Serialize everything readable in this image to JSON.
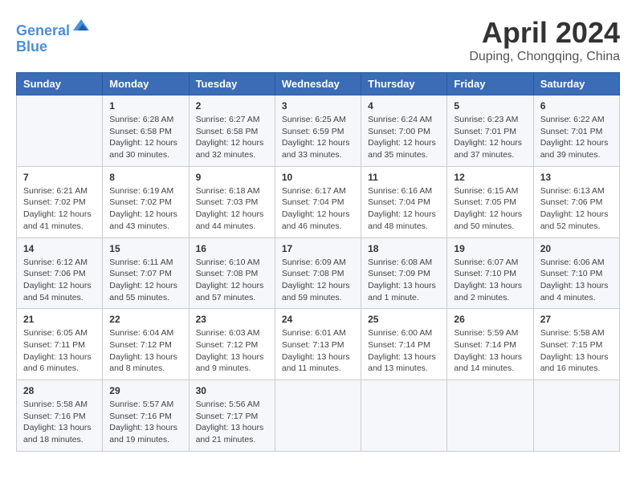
{
  "logo": {
    "line1": "General",
    "line2": "Blue"
  },
  "title": "April 2024",
  "subtitle": "Duping, Chongqing, China",
  "headers": [
    "Sunday",
    "Monday",
    "Tuesday",
    "Wednesday",
    "Thursday",
    "Friday",
    "Saturday"
  ],
  "weeks": [
    [
      {
        "day": "",
        "sunrise": "",
        "sunset": "",
        "daylight": ""
      },
      {
        "day": "1",
        "sunrise": "Sunrise: 6:28 AM",
        "sunset": "Sunset: 6:58 PM",
        "daylight": "Daylight: 12 hours and 30 minutes."
      },
      {
        "day": "2",
        "sunrise": "Sunrise: 6:27 AM",
        "sunset": "Sunset: 6:58 PM",
        "daylight": "Daylight: 12 hours and 32 minutes."
      },
      {
        "day": "3",
        "sunrise": "Sunrise: 6:25 AM",
        "sunset": "Sunset: 6:59 PM",
        "daylight": "Daylight: 12 hours and 33 minutes."
      },
      {
        "day": "4",
        "sunrise": "Sunrise: 6:24 AM",
        "sunset": "Sunset: 7:00 PM",
        "daylight": "Daylight: 12 hours and 35 minutes."
      },
      {
        "day": "5",
        "sunrise": "Sunrise: 6:23 AM",
        "sunset": "Sunset: 7:01 PM",
        "daylight": "Daylight: 12 hours and 37 minutes."
      },
      {
        "day": "6",
        "sunrise": "Sunrise: 6:22 AM",
        "sunset": "Sunset: 7:01 PM",
        "daylight": "Daylight: 12 hours and 39 minutes."
      }
    ],
    [
      {
        "day": "7",
        "sunrise": "Sunrise: 6:21 AM",
        "sunset": "Sunset: 7:02 PM",
        "daylight": "Daylight: 12 hours and 41 minutes."
      },
      {
        "day": "8",
        "sunrise": "Sunrise: 6:19 AM",
        "sunset": "Sunset: 7:02 PM",
        "daylight": "Daylight: 12 hours and 43 minutes."
      },
      {
        "day": "9",
        "sunrise": "Sunrise: 6:18 AM",
        "sunset": "Sunset: 7:03 PM",
        "daylight": "Daylight: 12 hours and 44 minutes."
      },
      {
        "day": "10",
        "sunrise": "Sunrise: 6:17 AM",
        "sunset": "Sunset: 7:04 PM",
        "daylight": "Daylight: 12 hours and 46 minutes."
      },
      {
        "day": "11",
        "sunrise": "Sunrise: 6:16 AM",
        "sunset": "Sunset: 7:04 PM",
        "daylight": "Daylight: 12 hours and 48 minutes."
      },
      {
        "day": "12",
        "sunrise": "Sunrise: 6:15 AM",
        "sunset": "Sunset: 7:05 PM",
        "daylight": "Daylight: 12 hours and 50 minutes."
      },
      {
        "day": "13",
        "sunrise": "Sunrise: 6:13 AM",
        "sunset": "Sunset: 7:06 PM",
        "daylight": "Daylight: 12 hours and 52 minutes."
      }
    ],
    [
      {
        "day": "14",
        "sunrise": "Sunrise: 6:12 AM",
        "sunset": "Sunset: 7:06 PM",
        "daylight": "Daylight: 12 hours and 54 minutes."
      },
      {
        "day": "15",
        "sunrise": "Sunrise: 6:11 AM",
        "sunset": "Sunset: 7:07 PM",
        "daylight": "Daylight: 12 hours and 55 minutes."
      },
      {
        "day": "16",
        "sunrise": "Sunrise: 6:10 AM",
        "sunset": "Sunset: 7:08 PM",
        "daylight": "Daylight: 12 hours and 57 minutes."
      },
      {
        "day": "17",
        "sunrise": "Sunrise: 6:09 AM",
        "sunset": "Sunset: 7:08 PM",
        "daylight": "Daylight: 12 hours and 59 minutes."
      },
      {
        "day": "18",
        "sunrise": "Sunrise: 6:08 AM",
        "sunset": "Sunset: 7:09 PM",
        "daylight": "Daylight: 13 hours and 1 minute."
      },
      {
        "day": "19",
        "sunrise": "Sunrise: 6:07 AM",
        "sunset": "Sunset: 7:10 PM",
        "daylight": "Daylight: 13 hours and 2 minutes."
      },
      {
        "day": "20",
        "sunrise": "Sunrise: 6:06 AM",
        "sunset": "Sunset: 7:10 PM",
        "daylight": "Daylight: 13 hours and 4 minutes."
      }
    ],
    [
      {
        "day": "21",
        "sunrise": "Sunrise: 6:05 AM",
        "sunset": "Sunset: 7:11 PM",
        "daylight": "Daylight: 13 hours and 6 minutes."
      },
      {
        "day": "22",
        "sunrise": "Sunrise: 6:04 AM",
        "sunset": "Sunset: 7:12 PM",
        "daylight": "Daylight: 13 hours and 8 minutes."
      },
      {
        "day": "23",
        "sunrise": "Sunrise: 6:03 AM",
        "sunset": "Sunset: 7:12 PM",
        "daylight": "Daylight: 13 hours and 9 minutes."
      },
      {
        "day": "24",
        "sunrise": "Sunrise: 6:01 AM",
        "sunset": "Sunset: 7:13 PM",
        "daylight": "Daylight: 13 hours and 11 minutes."
      },
      {
        "day": "25",
        "sunrise": "Sunrise: 6:00 AM",
        "sunset": "Sunset: 7:14 PM",
        "daylight": "Daylight: 13 hours and 13 minutes."
      },
      {
        "day": "26",
        "sunrise": "Sunrise: 5:59 AM",
        "sunset": "Sunset: 7:14 PM",
        "daylight": "Daylight: 13 hours and 14 minutes."
      },
      {
        "day": "27",
        "sunrise": "Sunrise: 5:58 AM",
        "sunset": "Sunset: 7:15 PM",
        "daylight": "Daylight: 13 hours and 16 minutes."
      }
    ],
    [
      {
        "day": "28",
        "sunrise": "Sunrise: 5:58 AM",
        "sunset": "Sunset: 7:16 PM",
        "daylight": "Daylight: 13 hours and 18 minutes."
      },
      {
        "day": "29",
        "sunrise": "Sunrise: 5:57 AM",
        "sunset": "Sunset: 7:16 PM",
        "daylight": "Daylight: 13 hours and 19 minutes."
      },
      {
        "day": "30",
        "sunrise": "Sunrise: 5:56 AM",
        "sunset": "Sunset: 7:17 PM",
        "daylight": "Daylight: 13 hours and 21 minutes."
      },
      {
        "day": "",
        "sunrise": "",
        "sunset": "",
        "daylight": ""
      },
      {
        "day": "",
        "sunrise": "",
        "sunset": "",
        "daylight": ""
      },
      {
        "day": "",
        "sunrise": "",
        "sunset": "",
        "daylight": ""
      },
      {
        "day": "",
        "sunrise": "",
        "sunset": "",
        "daylight": ""
      }
    ]
  ]
}
